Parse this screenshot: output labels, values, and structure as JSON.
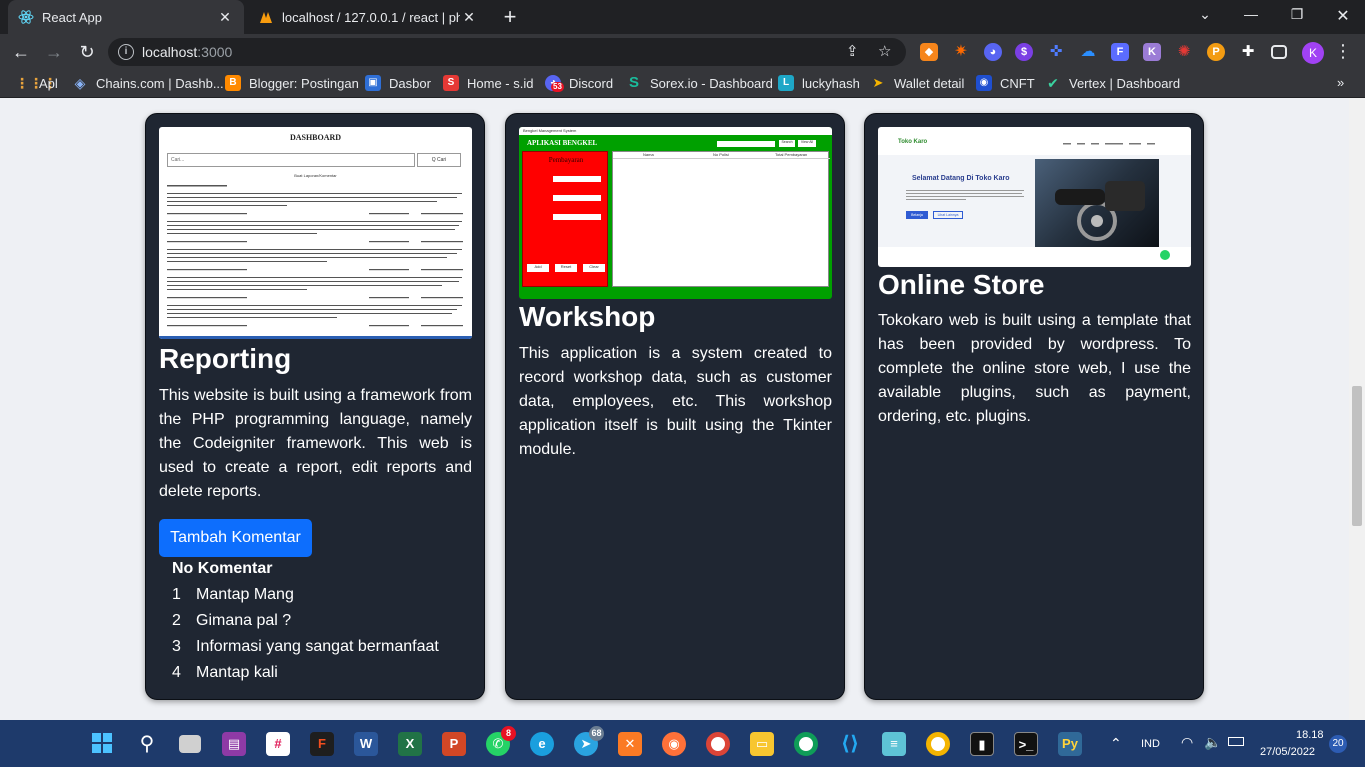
{
  "browser": {
    "tabs": [
      {
        "title": "React App"
      },
      {
        "title": "localhost / 127.0.0.1 / react | php"
      }
    ],
    "address": {
      "host": "localhost",
      "port": ":3000"
    },
    "profile_initial": "K",
    "extensions": [
      "metamask-icon",
      "star-burst-icon",
      "discord-ext-icon",
      "coin-icon",
      "satellite-icon",
      "cloud-icon",
      "f-icon",
      "k-icon",
      "loader-icon",
      "p-icon",
      "puzzle-icon"
    ],
    "bookmarks": [
      {
        "label": "Apl"
      },
      {
        "label": "Chains.com | Dashb..."
      },
      {
        "label": "Blogger: Postingan"
      },
      {
        "label": "Dasbor"
      },
      {
        "label": "Home - s.id"
      },
      {
        "label": "Discord",
        "badge": "53"
      },
      {
        "label": "Sorex.io - Dashboard"
      },
      {
        "label": "luckyhash"
      },
      {
        "label": "Wallet detail"
      },
      {
        "label": "CNFT"
      },
      {
        "label": "Vertex | Dashboard"
      }
    ]
  },
  "cards": [
    {
      "title": "Reporting",
      "description": "This website is built using a framework from the PHP programming language, namely the Codeigniter framework. This web is used to create a report, edit reports and delete reports.",
      "button_label": "Tambah Komentar",
      "thumb": {
        "heading": "DASHBOARD",
        "search_placeholder": "Cari...",
        "search_button": "Q Cari",
        "sub_label": "Buat Laporan/Komentar"
      },
      "comments_header": {
        "no": "No",
        "comment": "Komentar"
      },
      "comments": [
        {
          "no": "1",
          "text": "Mantap Mang"
        },
        {
          "no": "2",
          "text": "Gimana pal ?"
        },
        {
          "no": "3",
          "text": "Informasi yang sangat bermanfaat"
        },
        {
          "no": "4",
          "text": "Mantap kali"
        }
      ]
    },
    {
      "title": "Workshop",
      "description": "This application is a system created to record workshop data, such as customer data, employees, etc. This workshop application itself is built using the Tkinter module.",
      "thumb": {
        "window_title": "Bengkel Management System",
        "app_name": "APLIKASI BENGKEL",
        "panel_title": "Pembayaran",
        "buttons": [
          "Add",
          "Reset",
          "Clear"
        ],
        "top_buttons": [
          "Search",
          "View All"
        ],
        "columns": [
          "Nama",
          "No Polisi",
          "Total Pembayaran"
        ]
      }
    },
    {
      "title": "Online Store",
      "description": "Tokokaro web is built using a template that has been provided by wordpress. To complete the online store web, I use the available plugins, such as payment, ordering, etc. plugins.",
      "thumb": {
        "logo": "Toko Karo",
        "hero_title": "Selamat Datang Di Toko Karo",
        "btn1": "Belanja",
        "btn2": "Lihat Lainnya"
      }
    }
  ],
  "taskbar": {
    "whatsapp_badge": "8",
    "telegram_badge": "68",
    "tray": {
      "lang": "IND",
      "time": "18.18",
      "date": "27/05/2022",
      "notif": "20"
    }
  },
  "colors": {
    "card_bg": "#1f2632",
    "page_bg": "#eef0f4",
    "primary_button": "#0d6efd",
    "workshop_green": "#00a000",
    "workshop_red": "#ff0000"
  }
}
